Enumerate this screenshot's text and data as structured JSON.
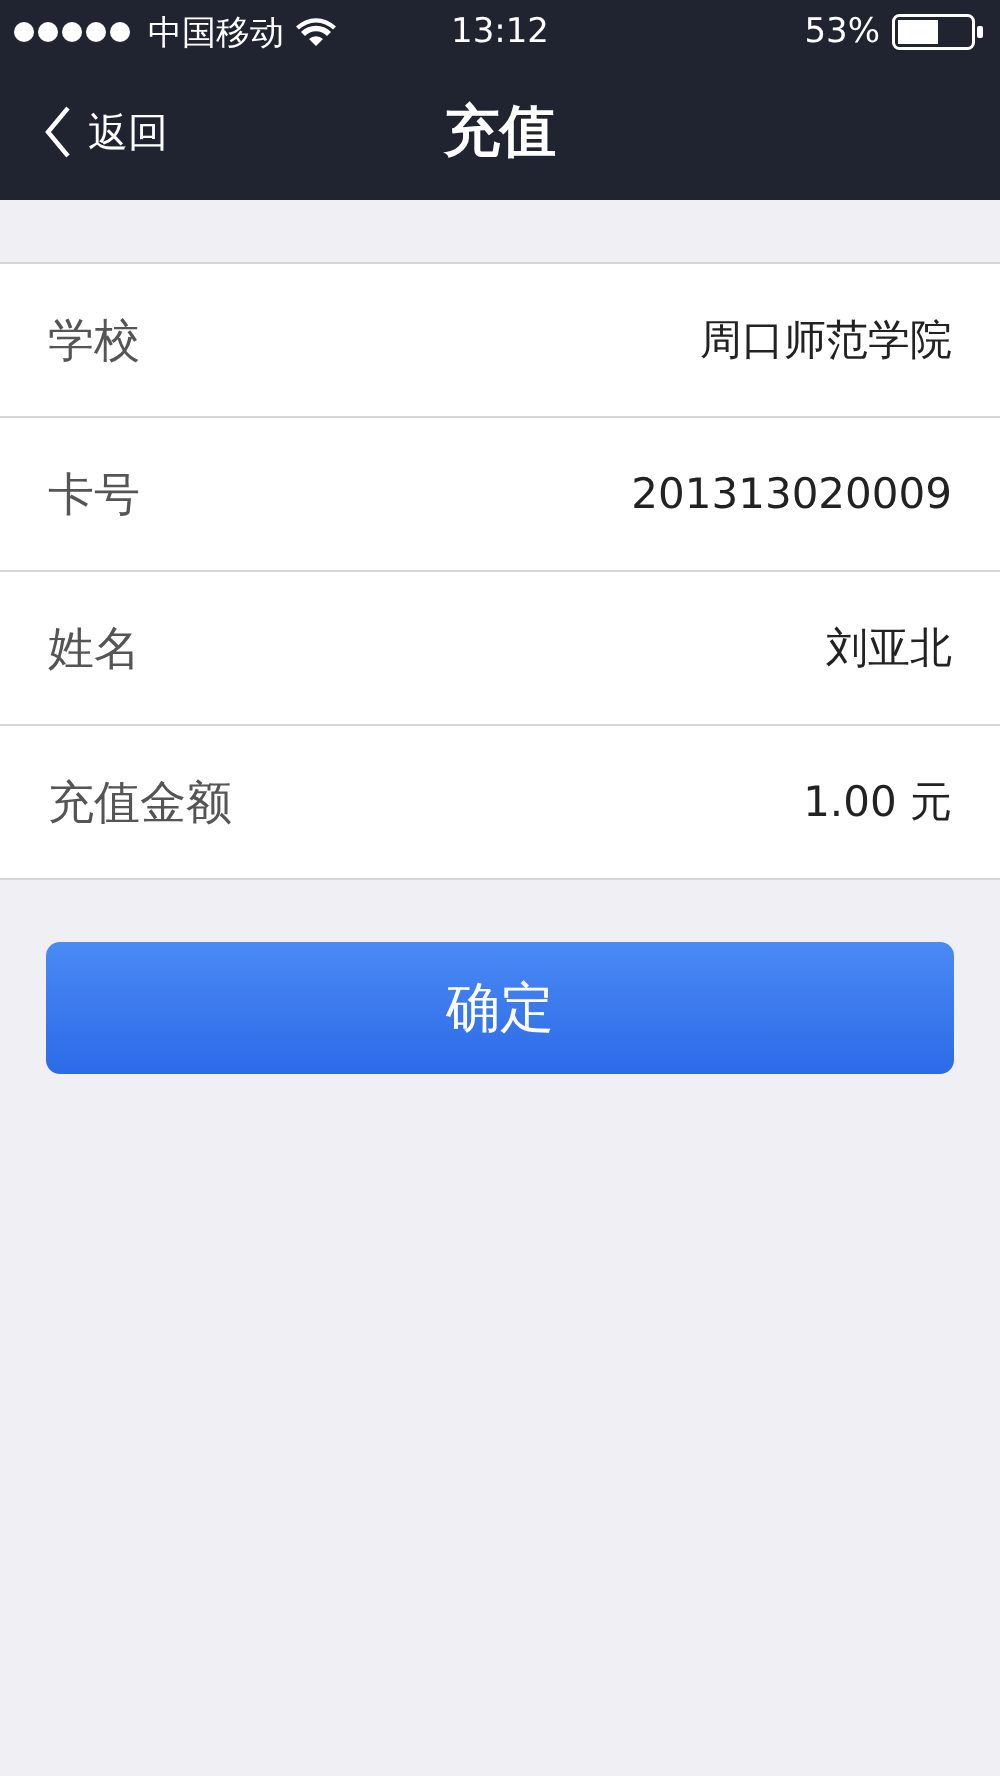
{
  "status_bar": {
    "carrier": "中国移动",
    "time": "13:12",
    "battery": "53%"
  },
  "nav": {
    "back": "返回",
    "title": "充值"
  },
  "rows": [
    {
      "label": "学校",
      "value": "周口师范学院"
    },
    {
      "label": "卡号",
      "value": "201313020009"
    },
    {
      "label": "姓名",
      "value": "刘亚北"
    },
    {
      "label": "充值金额",
      "value": "1.00 元"
    }
  ],
  "confirm_button": "确定"
}
